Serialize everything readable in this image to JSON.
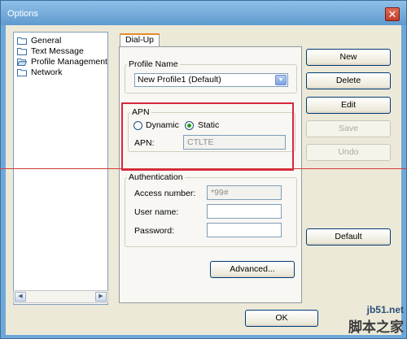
{
  "window": {
    "title": "Options",
    "close_glyph": "✕"
  },
  "sidebar": {
    "items": [
      {
        "label": "General",
        "icon": "folder-icon"
      },
      {
        "label": "Text Message",
        "icon": "folder-icon"
      },
      {
        "label": "Profile Management",
        "icon": "folder-open-icon"
      },
      {
        "label": "Network",
        "icon": "folder-icon"
      }
    ]
  },
  "tabs": [
    {
      "label": "Dial-Up"
    }
  ],
  "profile": {
    "legend": "Profile Name",
    "selected": "New Profile1 (Default)"
  },
  "apn": {
    "legend": "APN",
    "dynamic_label": "Dynamic",
    "static_label": "Static",
    "selected": "Static",
    "field_label": "APN:",
    "value": "CTLTE"
  },
  "auth": {
    "legend": "Authentication",
    "access_label": "Access number:",
    "access_value": "*99#",
    "user_label": "User name:",
    "user_value": "",
    "password_label": "Password:",
    "password_value": ""
  },
  "buttons": {
    "new": "New",
    "delete": "Delete",
    "edit": "Edit",
    "save": "Save",
    "undo": "Undo",
    "default": "Default",
    "advanced": "Advanced...",
    "ok": "OK"
  },
  "watermark": {
    "site": "jb51.net",
    "text": "脚本之家"
  },
  "colors": {
    "annotation_red": "#d7263d",
    "titlebar": "#6fa8d8",
    "tab_accent": "#e68b2c"
  }
}
